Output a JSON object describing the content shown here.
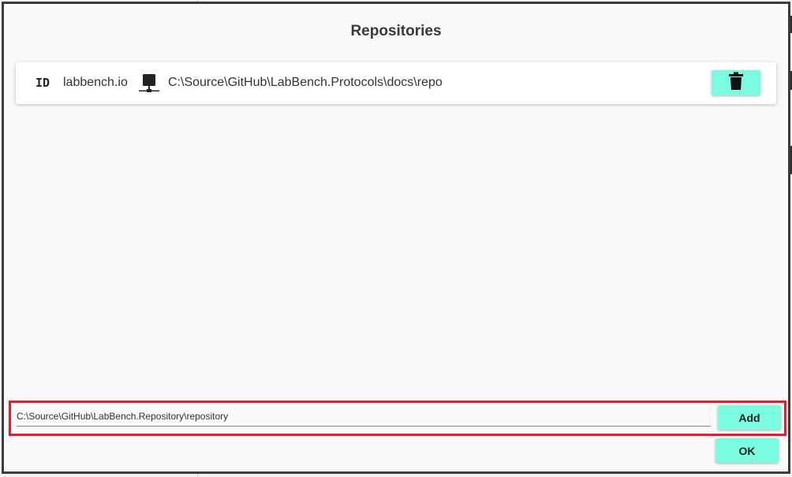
{
  "dialog": {
    "title": "Repositories"
  },
  "repositories": [
    {
      "id_icon": "ID",
      "name": "labbench.io",
      "type_icon": "network-drive-icon",
      "path": "C:\\Source\\GitHub\\LabBench.Protocols\\docs\\repo",
      "delete_icon": "trash-icon"
    }
  ],
  "add_form": {
    "path_value": "C:\\Source\\GitHub\\LabBench.Repository\\repository",
    "add_label": "Add"
  },
  "footer": {
    "ok_label": "OK"
  },
  "colors": {
    "accent": "#7bfbdf",
    "highlight_border": "#e0202c",
    "dialog_border": "#3c3c3c"
  }
}
